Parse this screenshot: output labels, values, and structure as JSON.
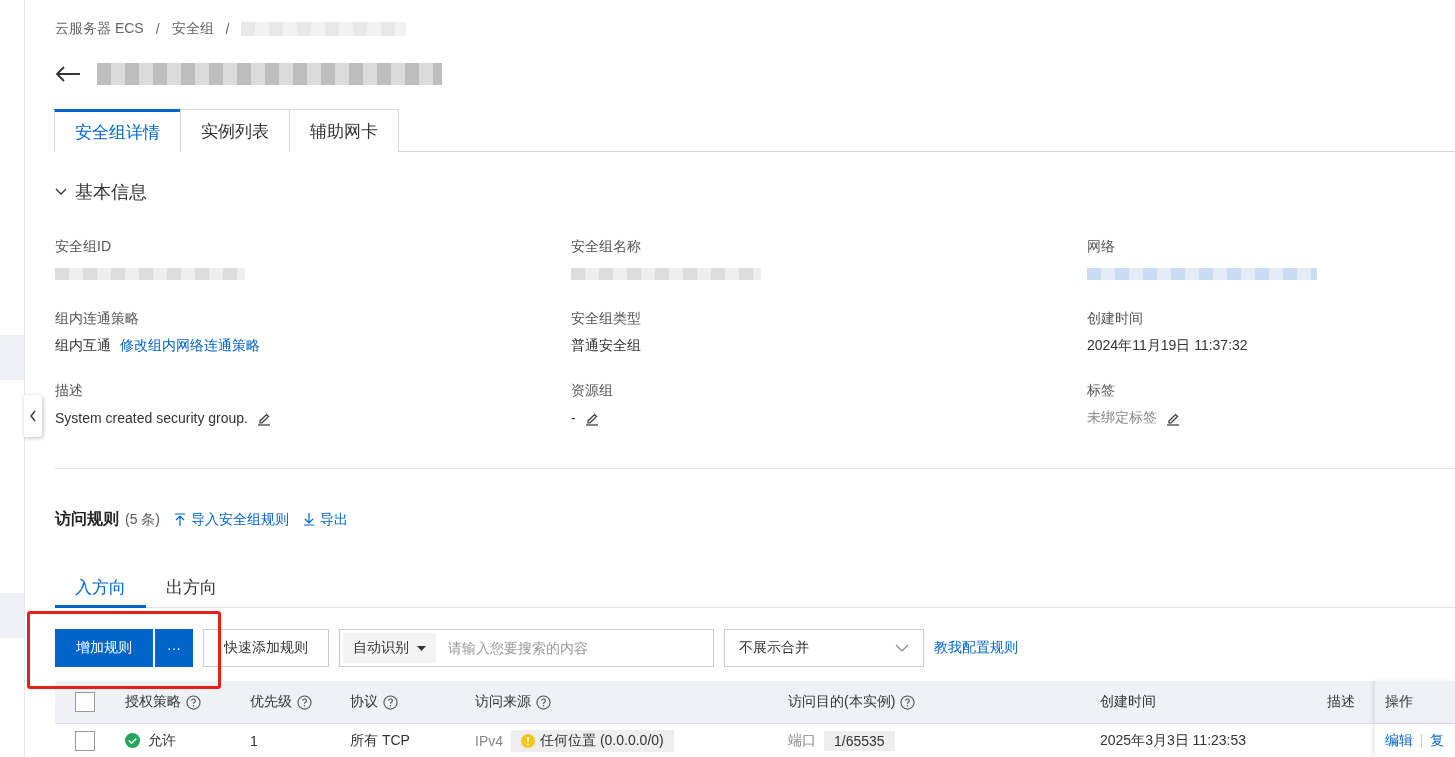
{
  "breadcrumb": [
    "云服务器 ECS",
    "安全组"
  ],
  "breadcrumb_separator": "/",
  "tabs": [
    {
      "label": "安全组详情",
      "selected": true
    },
    {
      "label": "实例列表",
      "selected": false
    },
    {
      "label": "辅助网卡",
      "selected": false
    }
  ],
  "basic_info": {
    "title": "基本信息",
    "expanded": true,
    "fields": [
      {
        "label": "安全组ID",
        "kind": "redacted"
      },
      {
        "label": "安全组名称",
        "kind": "redacted"
      },
      {
        "label": "网络",
        "kind": "redacted-link"
      },
      {
        "label": "组内连通策略",
        "kind": "text",
        "value": "组内互通",
        "link": "修改组内网络连通策略"
      },
      {
        "label": "安全组类型",
        "kind": "text",
        "value": "普通安全组"
      },
      {
        "label": "创建时间",
        "kind": "text",
        "value": "2024年11月19日 11:37:32"
      },
      {
        "label": "描述",
        "kind": "text",
        "value": "System created security group.",
        "editable": true
      },
      {
        "label": "资源组",
        "kind": "text",
        "value": "-",
        "editable": true
      },
      {
        "label": "标签",
        "kind": "muted",
        "value": "未绑定标签",
        "editable": true
      }
    ]
  },
  "rules": {
    "title": "访问规则",
    "count": "(5 条)",
    "actions": [
      {
        "kind": "import",
        "label": "导入安全组规则"
      },
      {
        "kind": "export",
        "label": "导出"
      }
    ],
    "direction_tabs": [
      {
        "label": "入方向",
        "selected": true
      },
      {
        "label": "出方向",
        "selected": false
      }
    ],
    "add_button": "增加规则",
    "more_button": "···",
    "quick_add_button": "快速添加规则",
    "search": {
      "mode": "自动识别",
      "placeholder": "请输入您要搜索的内容"
    },
    "merge_select": "不展示合并",
    "help_link": "教我配置规则",
    "select_all_checked": false,
    "columns": [
      {
        "label": "授权策略",
        "help": true
      },
      {
        "label": "优先级",
        "help": true
      },
      {
        "label": "协议",
        "help": true
      },
      {
        "label": "访问来源",
        "help": true
      },
      {
        "label": "访问目的(本实例)",
        "help": true
      },
      {
        "label": "创建时间",
        "help": false
      },
      {
        "label": "描述",
        "help": false
      },
      {
        "label": "操作",
        "help": false
      }
    ],
    "rows": [
      {
        "checked": false,
        "policy": "允许",
        "priority": "1",
        "protocol": "所有 TCP",
        "source_type": "IPv4",
        "source": "任何位置 (0.0.0.0/0)",
        "dest_label": "端口",
        "dest": "1/65535",
        "created": "2025年3月3日 11:23:53",
        "row_actions": [
          "编辑",
          "复"
        ]
      }
    ]
  }
}
